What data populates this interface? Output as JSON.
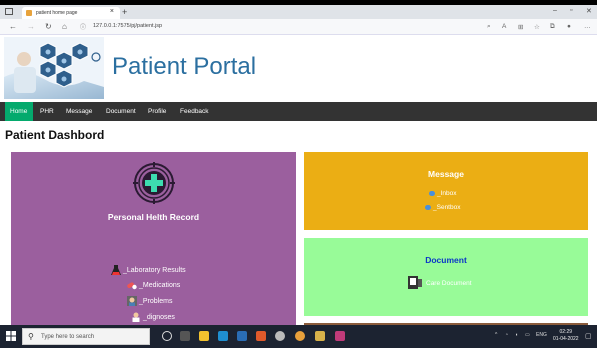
{
  "browser": {
    "tab_title": "patient home page",
    "url": "127.0.0.1:7575/pj/patient.jsp",
    "new_tab": "+"
  },
  "header": {
    "brand": "Patient Portal"
  },
  "menu": {
    "items": [
      {
        "label": "Home",
        "active": true
      },
      {
        "label": "PHR",
        "active": false
      },
      {
        "label": "Message",
        "active": false
      },
      {
        "label": "Document",
        "active": false
      },
      {
        "label": "Profile",
        "active": false
      },
      {
        "label": "Feedback",
        "active": false
      }
    ]
  },
  "dashboard": {
    "title": "Patient Dashbord",
    "phr": {
      "title": "Personal Helth Record",
      "links": [
        "_Laboratory Results",
        "_Medications",
        "_Problems",
        "_dignoses"
      ]
    },
    "message": {
      "title": "Message",
      "links": [
        "_Inbox",
        "_Sentbox"
      ]
    },
    "document": {
      "title": "Document",
      "link": "Care Document"
    }
  },
  "taskbar": {
    "search_placeholder": "Type here to search",
    "language": "ENG",
    "time": "02:29",
    "date": "01-04-2022"
  },
  "colors": {
    "menu_active": "#04aa6d",
    "menu_bg": "#333333",
    "phr_card": "#9b5f9e",
    "message_card": "#ebae14",
    "document_card": "#98fb98",
    "brand": "#2b6fa0"
  }
}
